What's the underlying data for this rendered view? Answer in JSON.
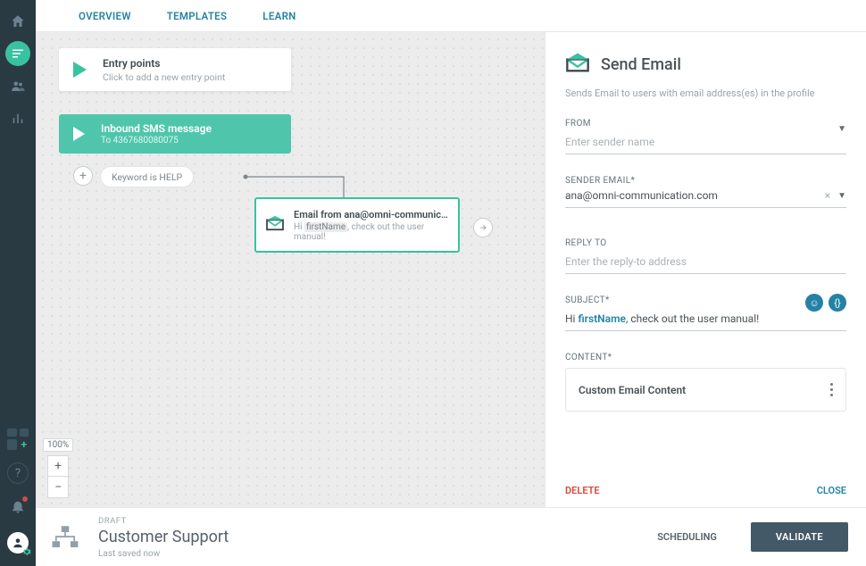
{
  "tabs": {
    "overview": "OVERVIEW",
    "templates": "TEMPLATES",
    "learn": "LEARN"
  },
  "entry": {
    "title": "Entry points",
    "subtitle": "Click to add a new entry point"
  },
  "sms": {
    "title": "Inbound SMS message",
    "subtitle": "To 4367680080075"
  },
  "keyword": "Keyword is HELP",
  "email_node": {
    "title": "Email from ana@omni-communic…",
    "preview_prefix": "Hi ",
    "preview_ph": "firstName",
    "preview_suffix": ", check out the user manual!"
  },
  "zoom": {
    "pct": "100%"
  },
  "panel": {
    "title": "Send Email",
    "desc": "Sends Email to users with email address(es) in the profile",
    "from_label": "FROM",
    "from_placeholder": "Enter sender name",
    "sender_label": "SENDER EMAIL*",
    "sender_value": "ana@omni-communication.com",
    "reply_label": "REPLY TO",
    "reply_placeholder": "Enter the reply-to address",
    "subject_label": "SUBJECT*",
    "subject_prefix": "Hi ",
    "subject_ph": "firstName",
    "subject_suffix": ", check out the user manual!",
    "content_label": "CONTENT*",
    "content_box": "Custom Email Content",
    "delete": "DELETE",
    "close": "CLOSE"
  },
  "footer": {
    "draft": "DRAFT",
    "title": "Customer Support",
    "saved": "Last saved now",
    "scheduling": "SCHEDULING",
    "validate": "VALIDATE"
  }
}
